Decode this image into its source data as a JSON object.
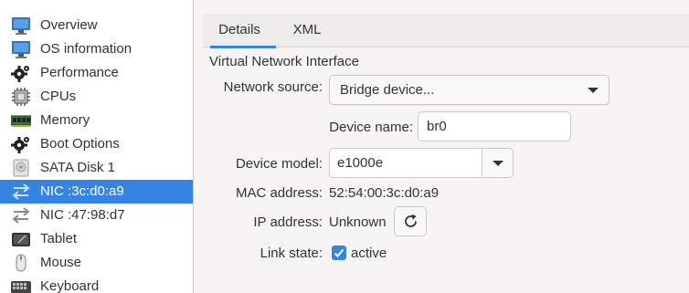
{
  "sidebar": {
    "items": [
      {
        "label": "Overview",
        "icon": "monitor-icon"
      },
      {
        "label": "OS information",
        "icon": "monitor-icon"
      },
      {
        "label": "Performance",
        "icon": "gear-icon"
      },
      {
        "label": "CPUs",
        "icon": "cpu-chip-icon"
      },
      {
        "label": "Memory",
        "icon": "memory-module-icon"
      },
      {
        "label": "Boot Options",
        "icon": "gear-icon"
      },
      {
        "label": "SATA Disk 1",
        "icon": "disk-icon"
      },
      {
        "label": "NIC :3c:d0:a9",
        "icon": "network-arrows-icon",
        "selected": true
      },
      {
        "label": "NIC :47:98:d7",
        "icon": "network-arrows-icon"
      },
      {
        "label": "Tablet",
        "icon": "tablet-icon"
      },
      {
        "label": "Mouse",
        "icon": "mouse-icon"
      },
      {
        "label": "Keyboard",
        "icon": "keyboard-icon"
      }
    ]
  },
  "tabs": [
    {
      "label": "Details",
      "active": true
    },
    {
      "label": "XML",
      "active": false
    }
  ],
  "details": {
    "section_title": "Virtual Network Interface",
    "network_source_label": "Network source:",
    "network_source_value": "Bridge device...",
    "device_name_label": "Device name:",
    "device_name_value": "br0",
    "device_model_label": "Device model:",
    "device_model_value": "e1000e",
    "mac_label": "MAC address:",
    "mac_value": "52:54:00:3c:d0:a9",
    "ip_label": "IP address:",
    "ip_value": "Unknown",
    "link_state_label": "Link state:",
    "link_state_value": "active",
    "link_state_checked": true
  },
  "colors": {
    "accent": "#3584e4",
    "selected_text": "#ffffff"
  }
}
